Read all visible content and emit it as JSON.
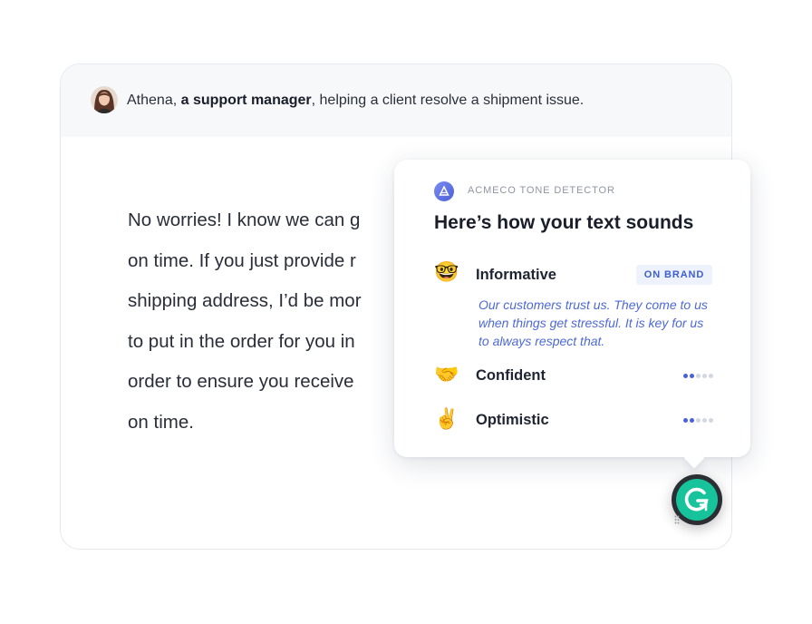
{
  "header": {
    "name": "Athena",
    "name_sep": ", ",
    "role": "a support manager",
    "context_rest": ", helping a client resolve a shipment issue."
  },
  "message": {
    "text": "No worries! I know we can g\non time. If you just provide r\nshipping address, I’d be mor\nto put in the order for you in\norder to ensure you receive\non time."
  },
  "panel": {
    "brand": "ACMECO TONE DETECTOR",
    "title": "Here’s how your text sounds",
    "tones": [
      {
        "label": "Informative",
        "emoji": "🤓",
        "badge": "ON BRAND",
        "note": "Our customers trust us. They come to us when things get stressful. It is key for us to always respect that."
      },
      {
        "label": "Confident",
        "emoji": "🤝",
        "level": 0.4
      },
      {
        "label": "Optimistic",
        "emoji": "✌️",
        "level": 0.4
      }
    ]
  },
  "colors": {
    "accent": "#3c5fd1",
    "grammarly_green": "#16c39a",
    "header_bg": "#f7f8fa"
  },
  "icons": {
    "avatar": "user-avatar",
    "brand": "tone-detector-logo",
    "assistant": "grammarly-g-icon"
  }
}
